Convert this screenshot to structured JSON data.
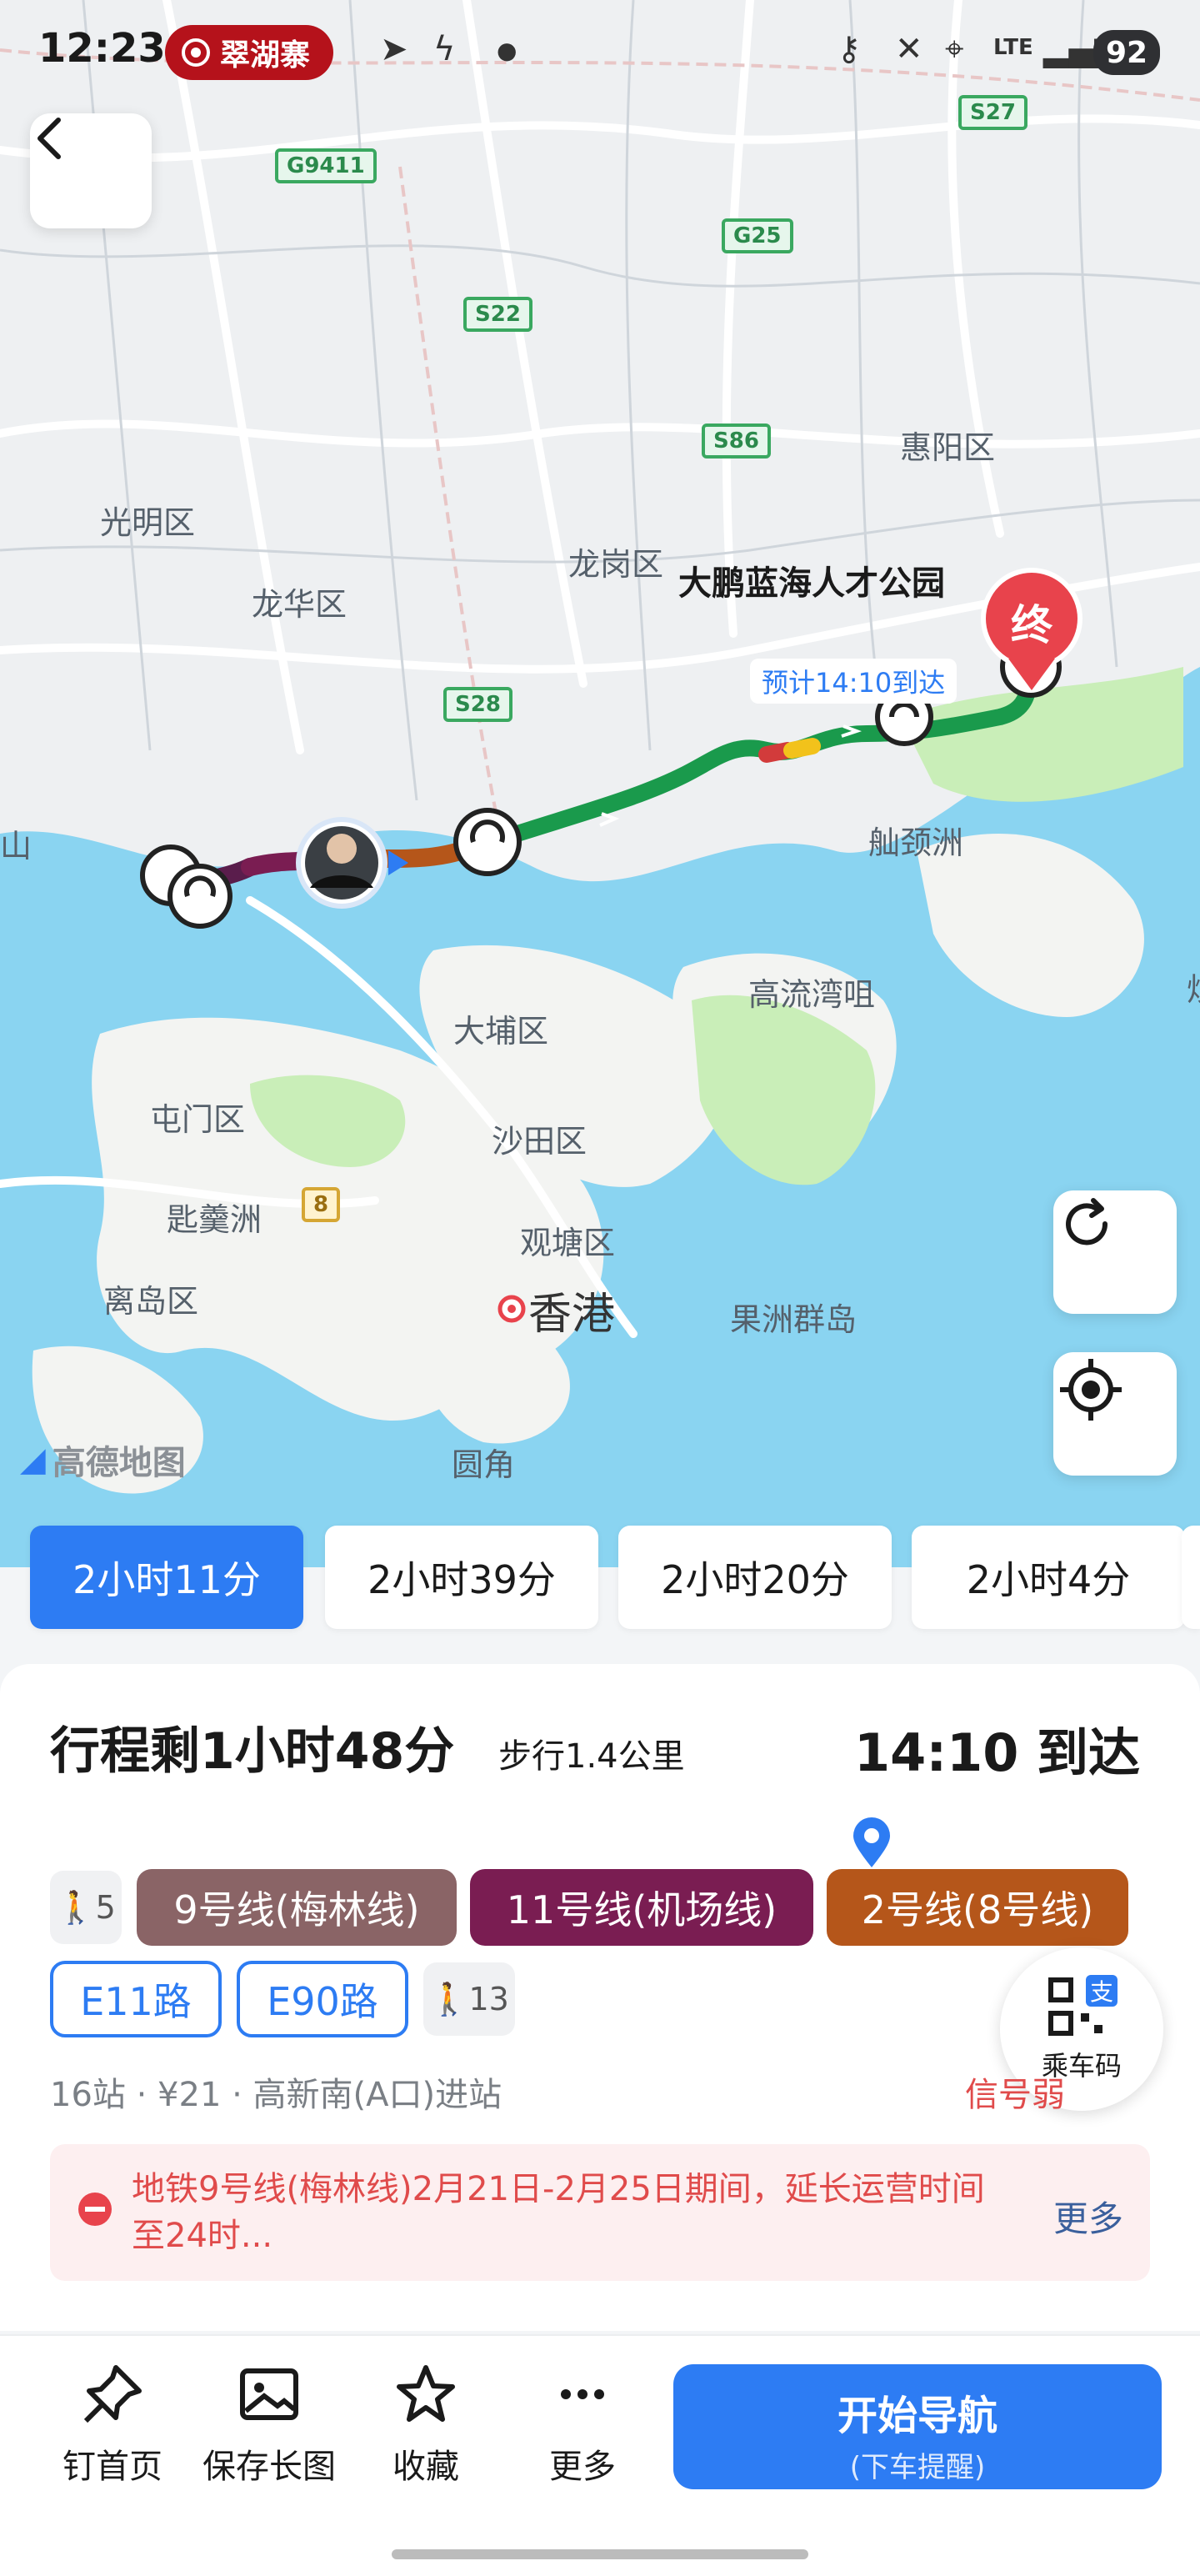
{
  "status_bar": {
    "time": "12:23",
    "badge": "翠湖寨",
    "network": "LTE",
    "battery": "92"
  },
  "map": {
    "attribution": "高德地图",
    "eta_bubble": "预计14:10到达",
    "destination_name": "大鹏蓝海人才公园",
    "destination_marker": "终",
    "places": [
      "光明区",
      "龙华区",
      "龙岗区",
      "惠阳区",
      "大埔区",
      "沙田区",
      "屯门区",
      "观塘区",
      "离岛区",
      "果洲群岛",
      "高流湾咀",
      "舢颈洲",
      "圆角",
      "香港",
      "匙羹洲"
    ],
    "roads": [
      "G9411",
      "S27",
      "G25",
      "S22",
      "S86",
      "S28",
      "8"
    ],
    "edge_labels": [
      "山",
      "炒"
    ]
  },
  "route_tabs": [
    {
      "label": "2小时11分",
      "active": true
    },
    {
      "label": "2小时39分",
      "active": false
    },
    {
      "label": "2小时20分",
      "active": false
    },
    {
      "label": "2小时4分",
      "active": false
    }
  ],
  "route_card": {
    "remaining": "行程剩1小时48分",
    "walk": "步行1.4公里",
    "arrival": "14:10 到达",
    "segments_row1": [
      {
        "type": "walk",
        "label": "5"
      },
      {
        "type": "line",
        "label": "9号线(梅林线)",
        "color": "#8a6466"
      },
      {
        "type": "line",
        "label": "11号线(机场线)",
        "color": "#7a1d52"
      },
      {
        "type": "line",
        "label": "2号线(8号线)",
        "color": "#b5561a"
      }
    ],
    "segments_row2": [
      {
        "type": "bus",
        "label": "E11路"
      },
      {
        "type": "bus",
        "label": "E90路"
      },
      {
        "type": "walk",
        "label": "13"
      }
    ],
    "summary": "16站 · ¥21 · 高新南(A口)进站",
    "signal": "信号弱",
    "qr_label": "乘车码",
    "notice": "地铁9号线(梅林线)2月21日-2月25日期间，延长运营时间至24时...",
    "notice_more": "更多"
  },
  "actions": [
    {
      "label": "钉首页",
      "icon": "pin-icon"
    },
    {
      "label": "保存长图",
      "icon": "image-icon"
    },
    {
      "label": "收藏",
      "icon": "star-icon"
    },
    {
      "label": "更多",
      "icon": "more-icon"
    }
  ],
  "nav_button": {
    "title": "开始导航",
    "subtitle": "(下车提醒)"
  }
}
